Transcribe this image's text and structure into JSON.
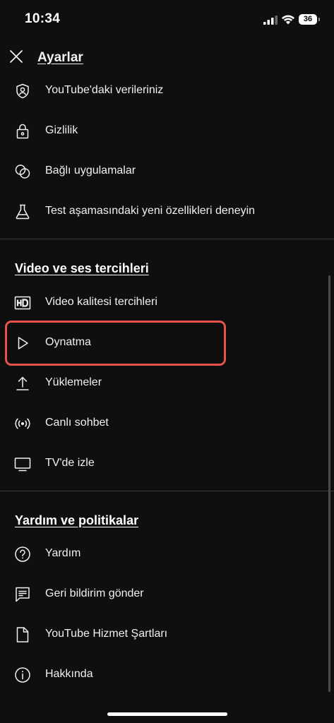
{
  "status_bar": {
    "time": "10:34",
    "battery": "36"
  },
  "header": {
    "title": "Ayarlar"
  },
  "account_items": [
    {
      "label": "YouTube'daki verileriniz",
      "icon": "shield-person-icon"
    },
    {
      "label": "Gizlilik",
      "icon": "lock-icon"
    },
    {
      "label": "Bağlı uygulamalar",
      "icon": "linked-circles-icon"
    },
    {
      "label": "Test aşamasındaki yeni özellikleri deneyin",
      "icon": "flask-icon"
    }
  ],
  "video_section": {
    "title": "Video ve ses tercihleri",
    "items": [
      {
        "label": "Video kalitesi tercihleri",
        "icon": "hd-icon"
      },
      {
        "label": "Oynatma",
        "icon": "play-icon"
      },
      {
        "label": "Yüklemeler",
        "icon": "upload-icon"
      },
      {
        "label": "Canlı sohbet",
        "icon": "live-broadcast-icon"
      },
      {
        "label": "TV'de izle",
        "icon": "tv-icon"
      }
    ]
  },
  "help_section": {
    "title": "Yardım ve politikalar",
    "items": [
      {
        "label": "Yardım",
        "icon": "help-icon"
      },
      {
        "label": "Geri bildirim gönder",
        "icon": "feedback-icon"
      },
      {
        "label": "YouTube Hizmet Şartları",
        "icon": "document-icon"
      },
      {
        "label": "Hakkında",
        "icon": "info-icon"
      }
    ]
  },
  "colors": {
    "background": "#0f0f0f",
    "text": "#f1f1f1",
    "divider": "#3a3a3a",
    "highlight": "#e5534b"
  }
}
